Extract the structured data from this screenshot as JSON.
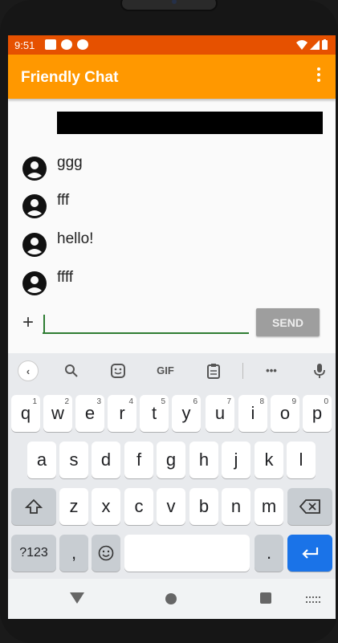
{
  "status": {
    "time": "9:51"
  },
  "app": {
    "title": "Friendly Chat"
  },
  "messages": [
    {
      "text": "ggg"
    },
    {
      "text": "fff"
    },
    {
      "text": "hello!"
    },
    {
      "text": "ffff"
    }
  ],
  "composer": {
    "plus": "+",
    "input_value": "",
    "send_label": "SEND"
  },
  "keyboard": {
    "toolbar": {
      "gif": "GIF",
      "more": "•••"
    },
    "row1": [
      {
        "k": "q",
        "h": "1"
      },
      {
        "k": "w",
        "h": "2"
      },
      {
        "k": "e",
        "h": "3"
      },
      {
        "k": "r",
        "h": "4"
      },
      {
        "k": "t",
        "h": "5"
      },
      {
        "k": "y",
        "h": "6"
      },
      {
        "k": "u",
        "h": "7"
      },
      {
        "k": "i",
        "h": "8"
      },
      {
        "k": "o",
        "h": "9"
      },
      {
        "k": "p",
        "h": "0"
      }
    ],
    "row2": [
      "a",
      "s",
      "d",
      "f",
      "g",
      "h",
      "j",
      "k",
      "l"
    ],
    "row3": [
      "z",
      "x",
      "c",
      "v",
      "b",
      "n",
      "m"
    ],
    "bottom": {
      "symbols": "?123",
      "comma": ",",
      "period": "."
    }
  }
}
